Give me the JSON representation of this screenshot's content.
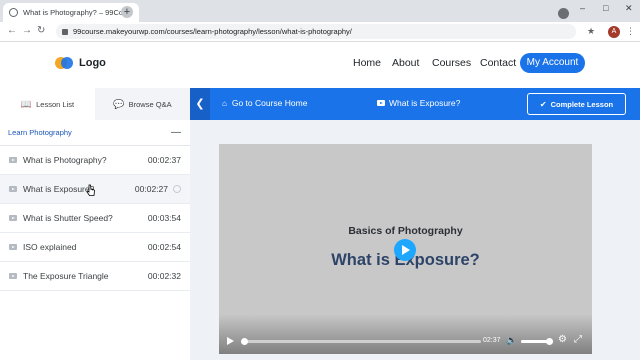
{
  "browser": {
    "tab_title": "What is Photography? – 99Cour...",
    "tab_close": "×",
    "new_tab": "+",
    "url": "99course.makeyourwp.com/courses/learn-photography/lesson/what-is-photography/",
    "back": "←",
    "forward": "→",
    "reload": "↻",
    "minimize": "–",
    "maximize": "□",
    "close": "✕",
    "extension": "★",
    "profile_initial": "A",
    "menu": "⋮"
  },
  "site": {
    "logo_text": "Logo",
    "nav": [
      "Home",
      "About",
      "Courses",
      "Contact"
    ],
    "account_label": "My Account"
  },
  "sidebar": {
    "tabs": [
      {
        "label": "Lesson List",
        "icon": "book-icon"
      },
      {
        "label": "Browse Q&A",
        "icon": "chat-icon"
      }
    ],
    "topic": {
      "title": "Learn Photography",
      "toggle": "—"
    },
    "lessons": [
      {
        "title": "What is Photography?",
        "duration": "00:02:37"
      },
      {
        "title": "What is Exposure?",
        "duration": "00:02:27"
      },
      {
        "title": "What is Shutter Speed?",
        "duration": "00:03:54"
      },
      {
        "title": "ISO explained",
        "duration": "00:02:54"
      },
      {
        "title": "The Exposure Triangle",
        "duration": "00:02:32"
      }
    ]
  },
  "lesson_bar": {
    "back_icon": "❮",
    "home_icon": "⌂",
    "home_link": "Go to Course Home",
    "current_title": "What is Exposure?",
    "complete_icon": "✔",
    "complete_label": "Complete Lesson",
    "accent": "#1a73e8"
  },
  "video": {
    "subtitle": "Basics of Photography",
    "title": "What is Exposure?",
    "time": "02:37",
    "progress": 0.0,
    "volume": 1.0,
    "volume_icon": "🔈",
    "settings_icon": "⚙",
    "fullscreen_icon": "⤢"
  }
}
